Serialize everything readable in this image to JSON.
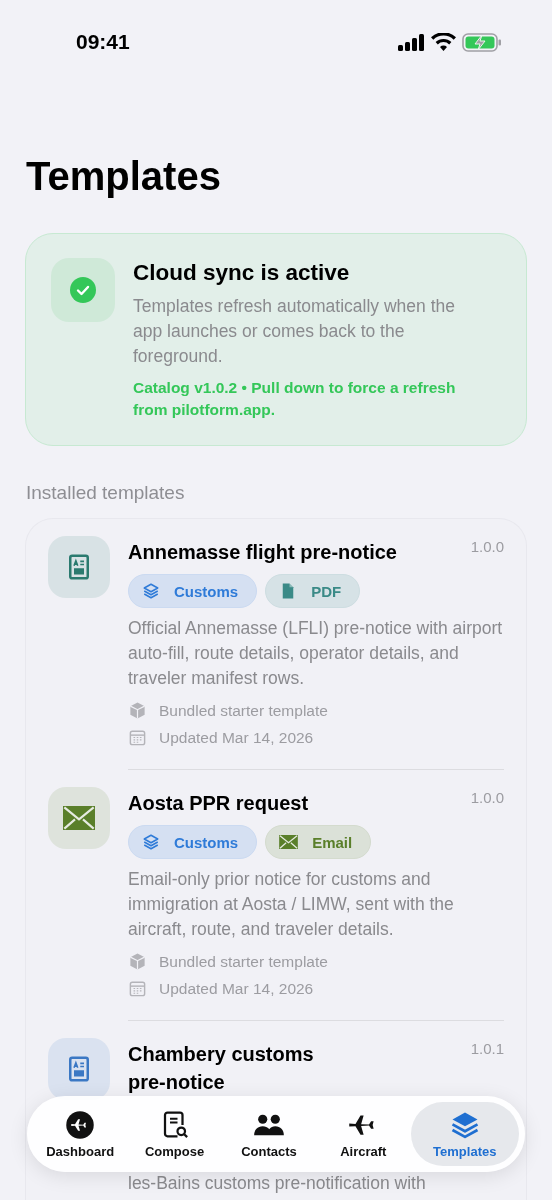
{
  "status_bar": {
    "time": "09:41"
  },
  "title": "Templates",
  "sync_card": {
    "title": "Cloud sync is active",
    "description": "Templates refresh automatically when the app launches or comes back to the foreground.",
    "note": "Catalog v1.0.2 • Pull down to force a refresh from pilotform.app."
  },
  "section_title": "Installed templates",
  "templates": [
    {
      "kind": "form",
      "color": "#2a7a6f",
      "title": "Annemasse flight pre-notice",
      "version": "1.0.0",
      "tags": [
        {
          "label": "Customs",
          "kind": "category",
          "color": "#2f7bd8"
        },
        {
          "label": "PDF",
          "kind": "document",
          "color": "#3a8a87"
        }
      ],
      "description": "Official Annemasse (LFLI) pre-notice with airport auto-fill, route details, operator details, and traveler manifest rows.",
      "meta": [
        {
          "kind": "source",
          "text": "Bundled starter template"
        },
        {
          "kind": "date",
          "text": "Updated Mar 14, 2026"
        }
      ]
    },
    {
      "kind": "email",
      "color": "#5a7f2a",
      "title": "Aosta PPR request",
      "version": "1.0.0",
      "tags": [
        {
          "label": "Customs",
          "kind": "category",
          "color": "#2f7bd8"
        },
        {
          "label": "Email",
          "kind": "email",
          "color": "#5a7f2a"
        }
      ],
      "description": "Email-only prior notice for customs and immigration at Aosta / LIMW, sent with the aircraft, route, and traveler details.",
      "meta": [
        {
          "kind": "source",
          "text": "Bundled starter template"
        },
        {
          "kind": "date",
          "text": "Updated Mar 14, 2026"
        }
      ]
    },
    {
      "kind": "form",
      "color": "#3b78c4",
      "title": "Chambery customs pre-notice",
      "version": "1.0.1",
      "description": "les-Bains customs pre-notification with"
    }
  ],
  "tab_bar": [
    {
      "label": "Dashboard",
      "selected": false
    },
    {
      "label": "Compose",
      "selected": false
    },
    {
      "label": "Contacts",
      "selected": false
    },
    {
      "label": "Aircraft",
      "selected": false
    },
    {
      "label": "Templates",
      "selected": true
    }
  ]
}
